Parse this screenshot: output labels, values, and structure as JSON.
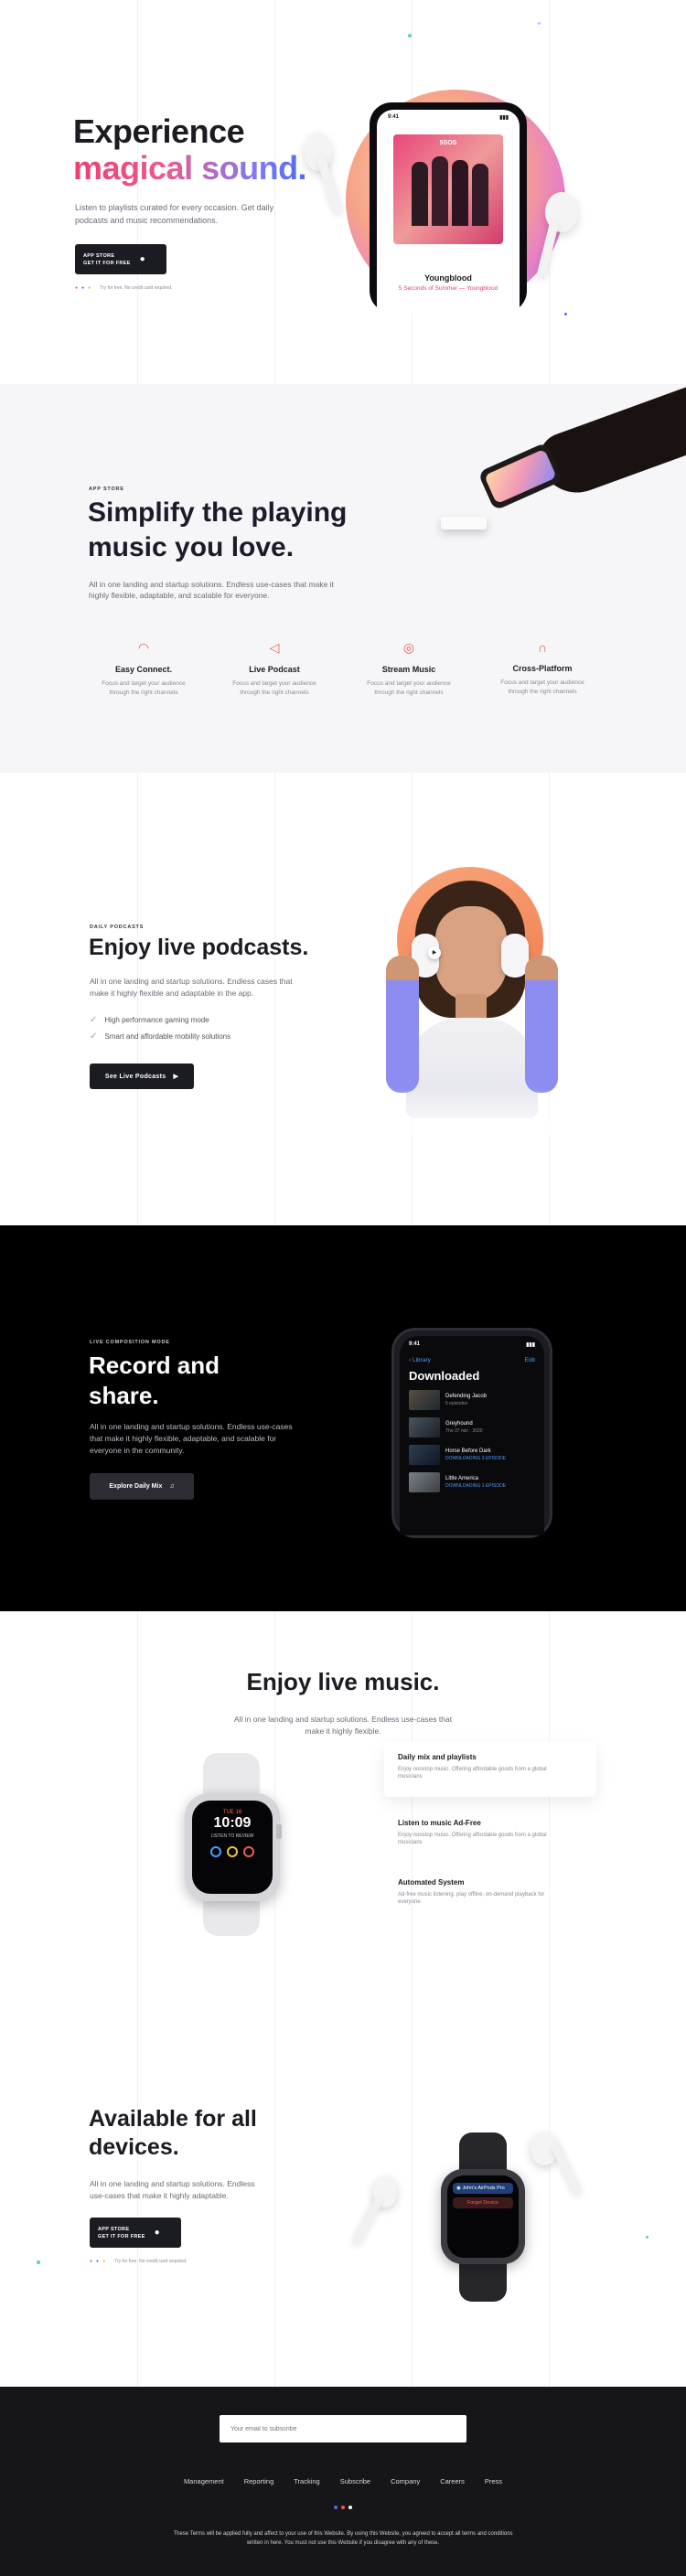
{
  "hero": {
    "title_line1": "Experience",
    "title_line2": "magical sound.",
    "subtitle_line1": "Listen to playlists curated for every occasion. Get daily",
    "subtitle_line2": "podcasts and music recommendations.",
    "store_button_line1": "APP STORE",
    "store_button_line2": "GET IT FOR FREE",
    "store_note": "Try for free. No credit card required.",
    "phone": {
      "time": "9:41",
      "album_title": "Youngblood",
      "album_artist": "5 Seconds of Summer — Youngblood",
      "album_cover_text": "5SOS"
    }
  },
  "features": {
    "eyebrow": "APP STORE",
    "title_line1": "Simplify the playing",
    "title_line2": "music you love.",
    "desc_line1": "All in one landing and startup solutions. Endless use-cases that make it",
    "desc_line2": "highly flexible, adaptable, and scalable for everyone.",
    "items": [
      {
        "icon": "wifi-icon",
        "title": "Easy Connect.",
        "desc1": "Focus and target your audience",
        "desc2": "through the right channels"
      },
      {
        "icon": "speaker-icon",
        "title": "Live Podcast",
        "desc1": "Focus and target your audience",
        "desc2": "through the right channels"
      },
      {
        "icon": "user-circle-icon",
        "title": "Stream Music",
        "desc1": "Focus and target your audience",
        "desc2": "through the right channels"
      },
      {
        "icon": "headphones-icon",
        "title": "Cross-Platform",
        "desc1": "Focus and target your audience",
        "desc2": "through the right channels"
      }
    ]
  },
  "podcasts": {
    "eyebrow": "DAILY PODCASTS",
    "title": "Enjoy live podcasts.",
    "desc_line1": "All in one landing and startup solutions. Endless cases that",
    "desc_line2": "make it highly flexible and adaptable in the app.",
    "bullets": [
      "High performance gaming mode",
      "Smart and affordable mobility solutions"
    ],
    "button_label": "See Live Podcasts"
  },
  "record": {
    "eyebrow": "LIVE COMPOSITION MODE",
    "title_line1": "Record and",
    "title_line2": "share.",
    "desc_line1": "All in one landing and startup solutions. Endless use-cases",
    "desc_line2": "that make it highly flexible, adaptable, and scalable for",
    "desc_line3": "everyone in the community.",
    "button_label": "Explore Daily Mix",
    "phone": {
      "time": "9:41",
      "back_label": "Library",
      "edit_label": "Edit",
      "header": "Downloaded",
      "items": [
        {
          "title": "Defending Jacob",
          "meta": "5 episodes"
        },
        {
          "title": "Greyhound",
          "meta": "The 37 min · 2020"
        },
        {
          "title": "Horse Before Dark",
          "meta": "DOWNLOADING 3 EPISODE"
        },
        {
          "title": "Little America",
          "meta": "DOWNLOADING 1 EPISODE"
        }
      ]
    }
  },
  "live_music": {
    "title": "Enjoy live music.",
    "desc_line1": "All in one landing and startup solutions. Endless use-cases that",
    "desc_line2": "make it highly flexible.",
    "watch": {
      "date": "TUE 16",
      "time": "10:09",
      "label": "LISTEN TO REVIEW"
    },
    "list": [
      {
        "title": "Daily mix and playlists",
        "desc1": "Enjoy nonstop music. Offering affordable goods from a global",
        "desc2": "musicians"
      },
      {
        "title": "Listen to music Ad-Free",
        "desc1": "Enjoy nonstop music. Offering affordable goods from a global",
        "desc2": "musicians"
      },
      {
        "title": "Automated System",
        "desc1": "Ad-free music listening, play offline, on-demand playback for",
        "desc2": "everyone"
      }
    ]
  },
  "available": {
    "title_line1": "Available for all",
    "title_line2": "devices.",
    "desc_line1": "All in one landing and startup solutions. Endless",
    "desc_line2": "use-cases that make it highly adaptable.",
    "store_button_line1": "APP STORE",
    "store_button_line2": "GET IT FOR FREE",
    "store_note": "Try for free. No credit card required.",
    "watch_line1": "John's AirPods Pro",
    "watch_line2": "Forget Device"
  },
  "footer": {
    "email_placeholder": "Your email to subscribe",
    "links": [
      "Management",
      "Reporting",
      "Tracking",
      "Subscribe",
      "Company",
      "Careers",
      "Press"
    ],
    "legal_line1": "These Terms will be applied fully and affect to your use of this Website. By using this Website, you agreed to accept all terms and conditions",
    "legal_line2": "written in here. You must not use this Website if you disagree with any of these."
  },
  "colors": {
    "accent": "#e5604a",
    "brand_gradient_start": "#ec3e6f",
    "brand_gradient_end": "#4b6cf0",
    "dark": "#1b1b22",
    "footer_bg": "#161618"
  }
}
